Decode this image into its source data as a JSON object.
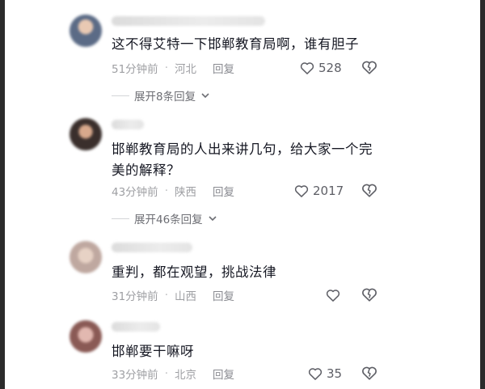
{
  "comments": [
    {
      "text": "这不得艾特一下邯郸教育局啊，谁有胆子",
      "time": "51分钟前",
      "location": "河北",
      "reply_label": "回复",
      "likes": "528",
      "expand_label": "展开8条回复"
    },
    {
      "text": "邯郸教育局的人出来讲几句，给大家一个完美的解释？",
      "time": "43分钟前",
      "location": "陕西",
      "reply_label": "回复",
      "likes": "2017",
      "expand_label": "展开46条回复"
    },
    {
      "text": "重判，都在观望，挑战法律",
      "time": "31分钟前",
      "location": "山西",
      "reply_label": "回复",
      "likes": ""
    },
    {
      "text": "邯郸要干嘛呀",
      "time": "33分钟前",
      "location": "北京",
      "reply_label": "回复",
      "likes": "35"
    }
  ],
  "meta_separator": "·",
  "icons": {
    "like": "heart-outline-icon",
    "dislike": "broken-heart-icon",
    "expand": "chevron-down-icon"
  },
  "colors": {
    "text": "#161823",
    "meta": "#9e9fa3",
    "icon": "#5d5e65"
  }
}
